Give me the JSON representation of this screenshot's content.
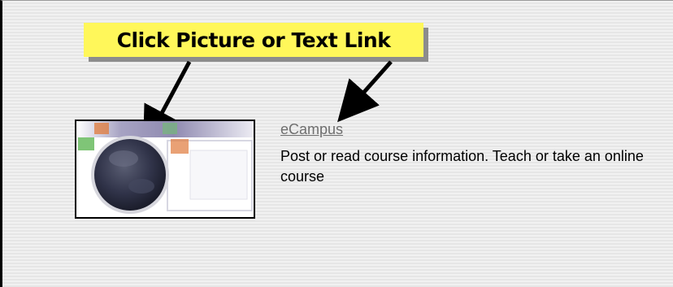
{
  "callout": {
    "text": "Click Picture or Text Link"
  },
  "item": {
    "link_text": "eCampus",
    "description": "Post or read course information. Teach or take an online course",
    "thumbnail_icon": "ecampus-globe-icon"
  },
  "colors": {
    "callout_background": "#fff75a",
    "link": "#6f6f6f",
    "arrow": "#000000"
  }
}
